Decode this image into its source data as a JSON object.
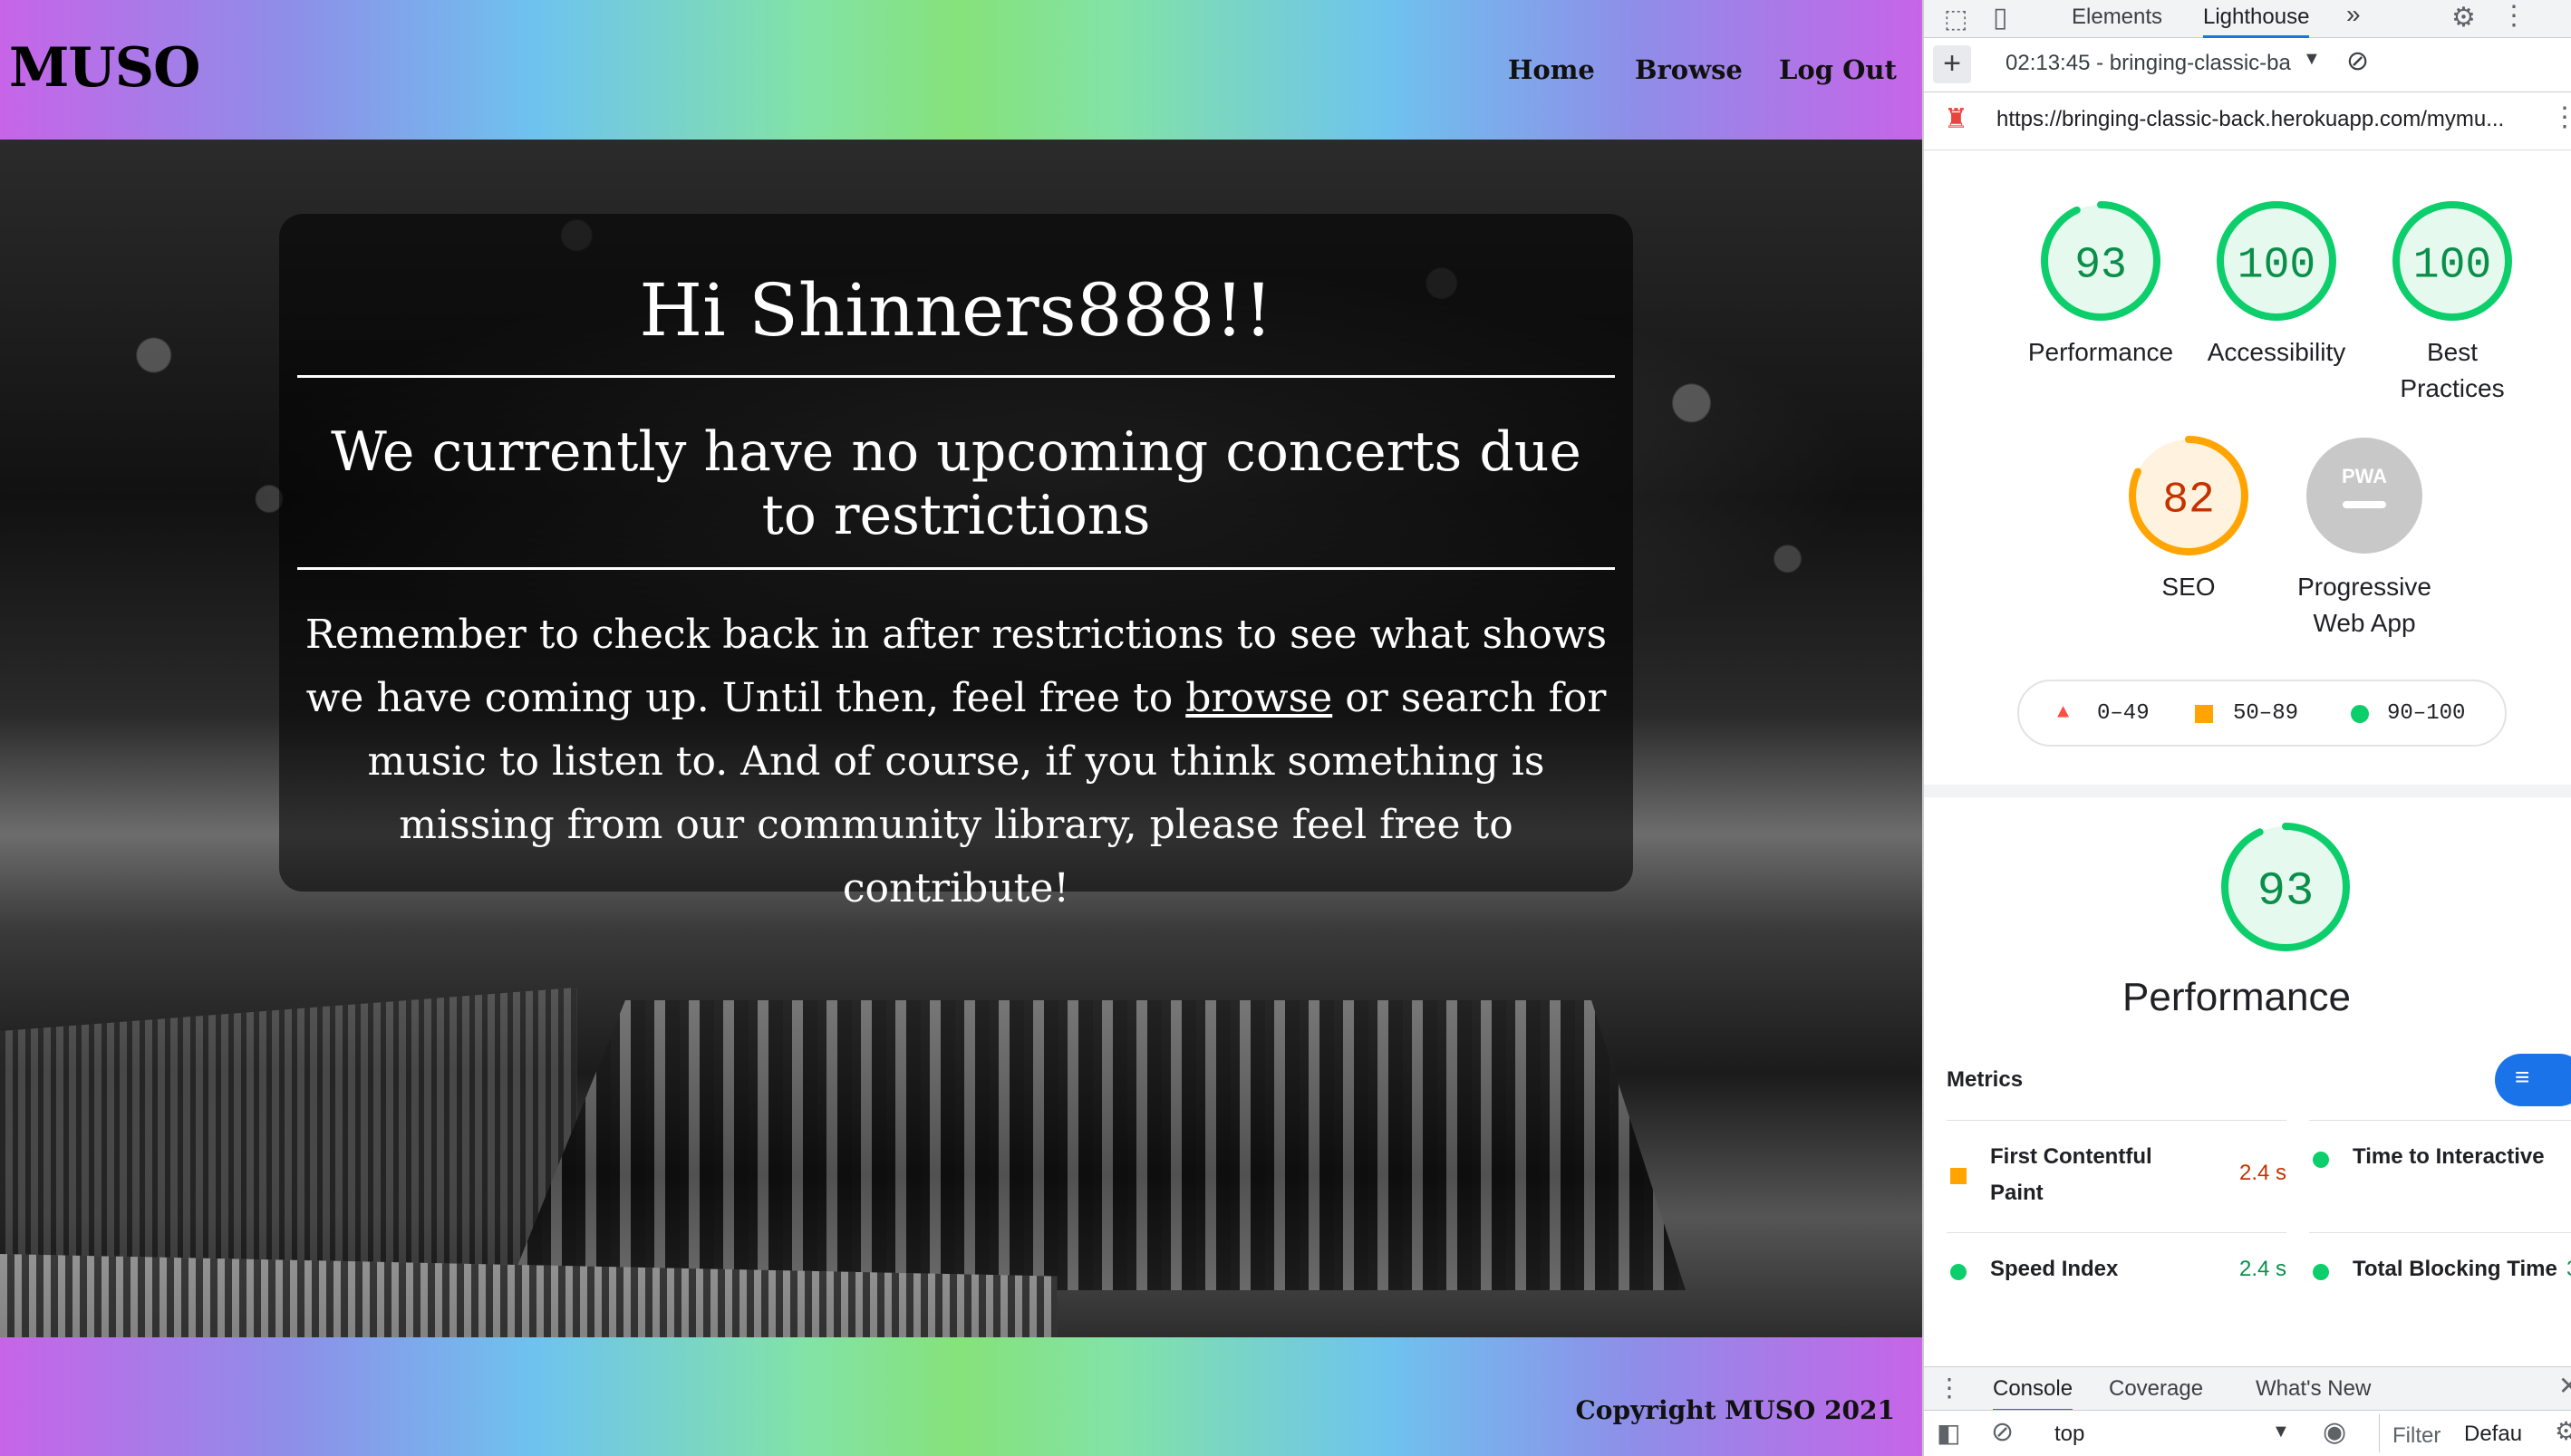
{
  "site": {
    "brand": "MUSO",
    "nav": {
      "home": "Home",
      "browse": "Browse",
      "logout": "Log Out"
    },
    "hero": {
      "greeting": "Hi Shinners888!!",
      "notice": "We currently have no upcoming concerts due to restrictions",
      "message_before": "Remember to check back in after restrictions to see what shows we have coming up. Until then, feel free to ",
      "message_link": "browse",
      "message_after": " or search for music to listen to. And of course, if you think something is missing from our community library, please feel free to contribute!"
    },
    "footer": "Copyright MUSO 2021"
  },
  "devtools": {
    "tabs": {
      "elements": "Elements",
      "lighthouse": "Lighthouse",
      "more": "»"
    },
    "report_selector": "02:13:45 - bringing-classic-ba",
    "url": "https://bringing-classic-back.herokuapp.com/mymu...",
    "scores": [
      {
        "label": "Performance",
        "value": "93",
        "fraction": 0.93,
        "color": "#0cce6b",
        "text_color": "#0a8f4a"
      },
      {
        "label": "Accessibility",
        "value": "100",
        "fraction": 1.0,
        "color": "#0cce6b",
        "text_color": "#0a8f4a"
      },
      {
        "label": "Best Practices",
        "value": "100",
        "fraction": 1.0,
        "color": "#0cce6b",
        "text_color": "#0a8f4a"
      },
      {
        "label": "SEO",
        "value": "82",
        "fraction": 0.82,
        "color": "#ffa400",
        "text_color": "#c33300"
      },
      {
        "label": "Progressive Web App",
        "value": "PWA",
        "fraction": 0,
        "color": "#c8c8c8",
        "text_color": "#ffffff"
      }
    ],
    "legend": [
      {
        "range": "0–49",
        "color": "#ff4e42",
        "shape": "triangle"
      },
      {
        "range": "50–89",
        "color": "#ffa400",
        "shape": "square"
      },
      {
        "range": "90–100",
        "color": "#0cce6b",
        "shape": "circle"
      }
    ],
    "performance_detail": {
      "value": "93",
      "label": "Performance",
      "fraction": 0.93
    },
    "metrics_title": "Metrics",
    "metrics": [
      {
        "name": "First Contentful Paint",
        "value": "2.4 s",
        "status": "average"
      },
      {
        "name": "Time to Interactive",
        "value": "",
        "status": "pass"
      },
      {
        "name": "Speed Index",
        "value": "2.4 s",
        "status": "pass"
      },
      {
        "name": "Total Blocking Time",
        "value": "3",
        "status": "pass"
      }
    ],
    "drawer_tabs": {
      "console": "Console",
      "coverage": "Coverage",
      "whats_new": "What's New"
    },
    "console": {
      "context": "top",
      "filter": "Filter",
      "level": "Defau"
    }
  }
}
